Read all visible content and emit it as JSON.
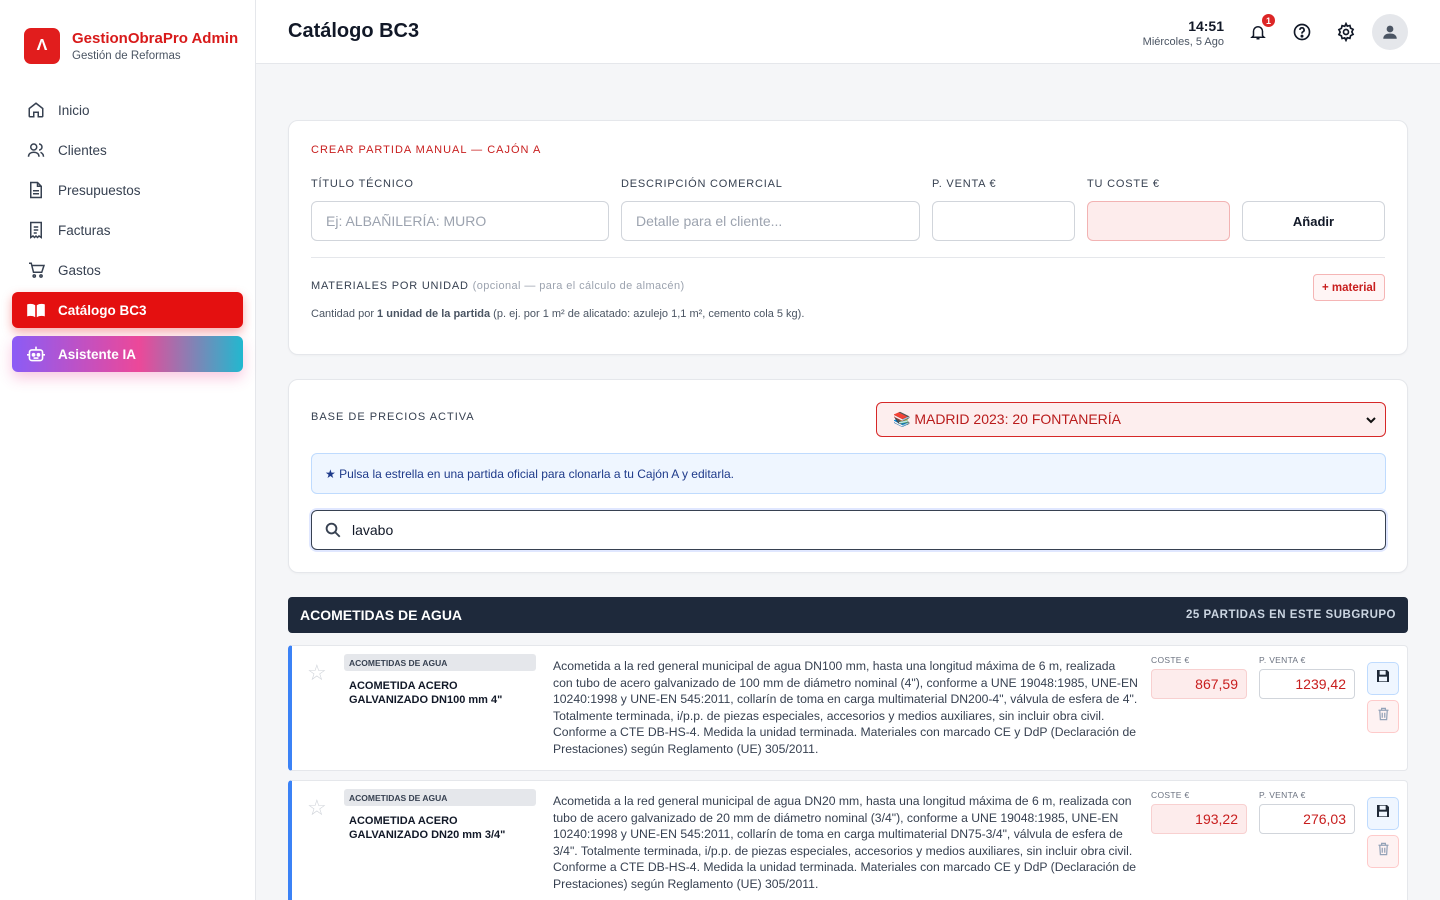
{
  "brand": {
    "title": "GestionObraPro Admin",
    "subtitle": "Gestión de Reformas",
    "logo_glyph": "Ʌ"
  },
  "nav": [
    {
      "label": "Inicio",
      "icon": "home-icon"
    },
    {
      "label": "Clientes",
      "icon": "users-icon"
    },
    {
      "label": "Presupuestos",
      "icon": "document-icon"
    },
    {
      "label": "Facturas",
      "icon": "invoice-icon"
    },
    {
      "label": "Gastos",
      "icon": "cart-icon"
    },
    {
      "label": "Catálogo BC3",
      "icon": "book-icon",
      "active": true
    },
    {
      "label": "Asistente IA",
      "icon": "robot-icon"
    }
  ],
  "header": {
    "title": "Catálogo BC3",
    "time": "14:51",
    "date": "Miércoles, 5 Ago",
    "notifications": "1"
  },
  "manual": {
    "title": "CREAR PARTIDA MANUAL — CAJÓN A",
    "labels": {
      "titulo": "TÍTULO TÉCNICO",
      "descripcion": "DESCRIPCIÓN COMERCIAL",
      "venta": "P. VENTA €",
      "coste": "TU COSTE €"
    },
    "placeholders": {
      "titulo": "Ej: ALBAÑILERÍA: MURO",
      "descripcion": "Detalle para el cliente..."
    },
    "add_button": "Añadir",
    "materials_title": "MATERIALES POR UNIDAD",
    "materials_optional": "(opcional — para el cálculo de almacén)",
    "add_material": "+ material",
    "help_prefix": "Cantidad por ",
    "help_bold": "1 unidad de la partida",
    "help_suffix": " (p. ej. por 1 m² de alicatado: azulejo 1,1 m², cemento cola 5 kg)."
  },
  "pricebase": {
    "label": "BASE DE PRECIOS ACTIVA",
    "selected": "📚 MADRID 2023: 20 FONTANERÍA",
    "info": "★ Pulsa la estrella en una partida oficial para clonarla a tu Cajón A y editarla.",
    "search_value": "lavabo"
  },
  "group": {
    "name": "ACOMETIDAS DE AGUA",
    "count": "25 PARTIDAS EN ESTE SUBGRUPO"
  },
  "rows": [
    {
      "chip": "ACOMETIDAS DE AGUA",
      "name": "ACOMETIDA ACERO GALVANIZADO DN100 mm 4\"",
      "description": "Acometida a la red general municipal de agua DN100 mm, hasta una longitud máxima de 6 m, realizada con tubo de acero galvanizado de 100 mm de diámetro nominal (4\"), conforme a UNE 19048:1985, UNE-EN 10240:1998 y UNE-EN 545:2011, collarín de toma en carga multimaterial DN200-4\", válvula de esfera de 4\". Totalmente terminada, i/p.p. de piezas especiales, accesorios y medios auxiliares, sin incluir obra civil. Conforme a CTE DB-HS-4. Medida la unidad terminada. Materiales con marcado CE y DdP (Declaración de Prestaciones) según Reglamento (UE) 305/2011.",
      "cost_label": "COSTE €",
      "cost": "867,59",
      "sale_label": "P. VENTA €",
      "sale": "1239,42"
    },
    {
      "chip": "ACOMETIDAS DE AGUA",
      "name": "ACOMETIDA ACERO GALVANIZADO DN20 mm 3/4\"",
      "description": "Acometida a la red general municipal de agua DN20 mm, hasta una longitud máxima de 6 m, realizada con tubo de acero galvanizado de 20 mm de diámetro nominal (3/4\"), conforme a UNE 19048:1985, UNE-EN 10240:1998 y UNE-EN 545:2011, collarín de toma en carga multimaterial DN75-3/4\", válvula de esfera de 3/4\". Totalmente terminada, i/p.p. de piezas especiales, accesorios y medios auxiliares, sin incluir obra civil. Conforme a CTE DB-HS-4. Medida la unidad terminada. Materiales con marcado CE y DdP (Declaración de Prestaciones) según Reglamento (UE) 305/2011.",
      "cost_label": "COSTE €",
      "cost": "193,22",
      "sale_label": "P. VENTA €",
      "sale": "276,03"
    }
  ],
  "colors": {
    "brand_red": "#e41010",
    "group_header": "#1e293b",
    "row_accent": "#3b82f6"
  }
}
